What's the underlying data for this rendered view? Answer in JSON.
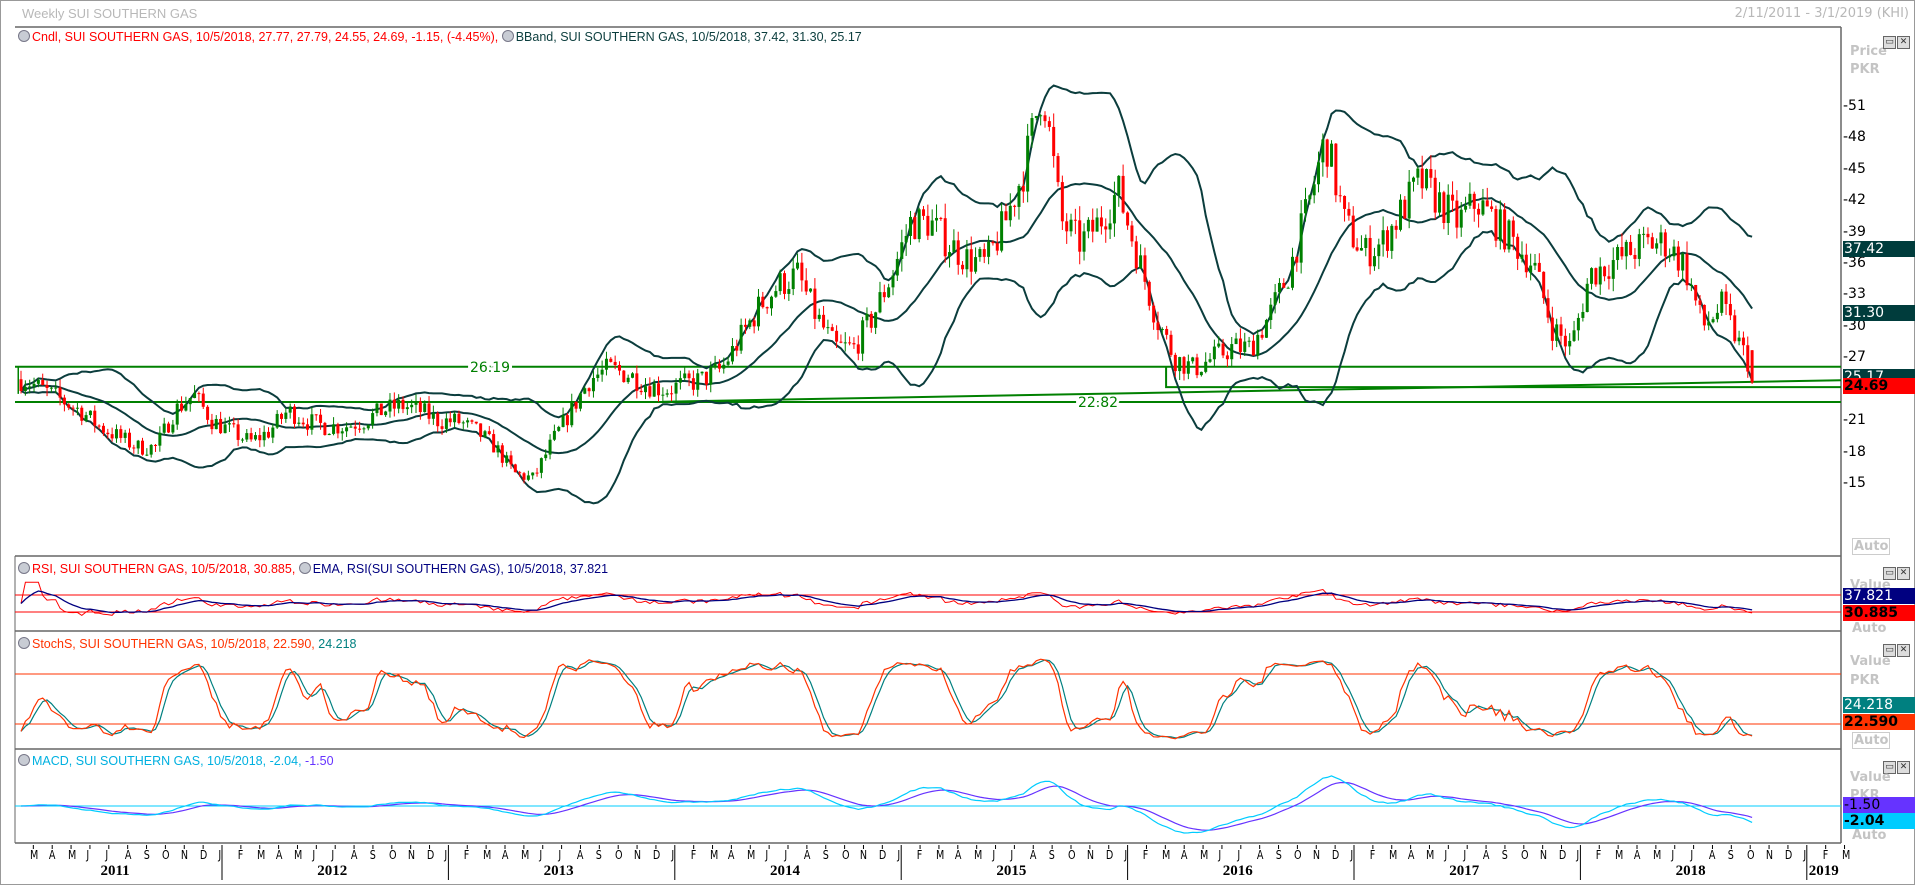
{
  "window": {
    "title": "Weekly SUI SOUTHERN GAS",
    "date_range": "2/11/2011 - 3/1/2019 (KHI)"
  },
  "price_pane": {
    "legend_candle": "Cndl, SUI SOUTHERN GAS, 10/5/2018, 27.77, 27.79, 24.55, 24.69, -1.15, (-4.45%),",
    "legend_bband": "BBand, SUI SOUTHERN GAS, 10/5/2018, 37.42, 31.30, 25.17",
    "axis_title": "Price",
    "axis_unit": "PKR",
    "auto_label": "Auto",
    "ticks": [
      51,
      48,
      45,
      42,
      39,
      36,
      33,
      30,
      27,
      24,
      21,
      18,
      15
    ],
    "value_boxes": [
      {
        "label": "37.42",
        "value": 37.42,
        "bg": "#003c3c",
        "fg": "#ffffff"
      },
      {
        "label": "31.30",
        "value": 31.3,
        "bg": "#003c3c",
        "fg": "#ffffff"
      },
      {
        "label": "25.17",
        "value": 25.17,
        "bg": "#003c3c",
        "fg": "#ffffff"
      },
      {
        "label": "24.69",
        "value": 24.69,
        "bg": "#ff0000",
        "fg": "#000000"
      }
    ],
    "hlines": [
      {
        "label": "26.19",
        "value": 26.19
      },
      {
        "label": "22.82",
        "value": 22.82
      }
    ]
  },
  "rsi_pane": {
    "legend_rsi": "RSI, SUI SOUTHERN GAS, 10/5/2018, 30.885,",
    "legend_ema": "EMA, RSI(SUI SOUTHERN GAS), 10/5/2018, 37.821",
    "axis_title": "Value",
    "auto_label": "Auto",
    "box_ema": "37.821",
    "box_rsi": "30.885"
  },
  "stoch_pane": {
    "legend_a": "StochS, SUI SOUTHERN GAS, 10/5/2018, 22.590,",
    "legend_b": "24.218",
    "axis_title": "Value",
    "axis_unit": "PKR",
    "auto_label": "Auto",
    "box_teal": "24.218",
    "box_red": "22.590"
  },
  "macd_pane": {
    "legend_a": "MACD, SUI SOUTHERN GAS, 10/5/2018, -2.04,",
    "legend_b": "-1.50",
    "axis_title": "Value",
    "axis_unit": "PKR",
    "auto_label": "Auto",
    "box_signal": "-1.50",
    "box_macd": "-2.04"
  },
  "time_axis": {
    "month_letters": [
      "J",
      "F",
      "M",
      "A",
      "M",
      "J",
      "J",
      "A",
      "S",
      "O",
      "N",
      "D"
    ],
    "years": [
      "2011",
      "2012",
      "2013",
      "2014",
      "2015",
      "2016",
      "2017",
      "2018",
      "2019"
    ]
  },
  "colors": {
    "up": "#008000",
    "down": "#ff0000",
    "bband": "#0b3d3d",
    "trend": "#008000",
    "rsi": "#ff0000",
    "rsi_ema": "#000080",
    "stoch_k": "#ff3300",
    "stoch_d": "#008080",
    "macd": "#00ccff",
    "signal": "#6633ff"
  },
  "chart_data": {
    "type": "candlestick",
    "interval": "weekly",
    "start": "2011-02-11",
    "end": "2018-10-05",
    "approx_monthly_close": {
      "2011": [
        null,
        25,
        24,
        23,
        22,
        20.5,
        19.5,
        18.5,
        18.5,
        22,
        23.5,
        21
      ],
      "2012": [
        20,
        19,
        20,
        22,
        21,
        20.5,
        20.5,
        21,
        22,
        22.5,
        22,
        21
      ],
      "2013": [
        21,
        20,
        18.5,
        16,
        15.5,
        19,
        22,
        25,
        26,
        25.5,
        24.5,
        24
      ],
      "2014": [
        24.5,
        25,
        26,
        29,
        32,
        34,
        35,
        31,
        28,
        28,
        31,
        35
      ],
      "2015": [
        40,
        40,
        38,
        36.5,
        36,
        40,
        45,
        53,
        40,
        38,
        40,
        43
      ],
      "2016": [
        37,
        31,
        27,
        26,
        27,
        28,
        28,
        31,
        35,
        41,
        48,
        40
      ],
      "2017": [
        37,
        38,
        41,
        44,
        42,
        40,
        42,
        40,
        38,
        36,
        30,
        28
      ],
      "2018": [
        35,
        36,
        37,
        38,
        38,
        36,
        30,
        32,
        28,
        24.69
      ]
    },
    "last_candle": {
      "date": "10/5/2018",
      "open": 27.77,
      "high": 27.79,
      "low": 24.55,
      "close": 24.69,
      "change": -1.15,
      "change_pct": -4.45
    },
    "bband_last": {
      "upper": 37.42,
      "middle": 31.3,
      "lower": 25.17
    },
    "rsi_last": 30.885,
    "rsi_ema_last": 37.821,
    "stoch_last": [
      22.59,
      24.218
    ],
    "macd_last": [
      -2.04,
      -1.5
    ],
    "y_axis": {
      "label": "Price PKR",
      "range": [
        14,
        57
      ]
    }
  }
}
